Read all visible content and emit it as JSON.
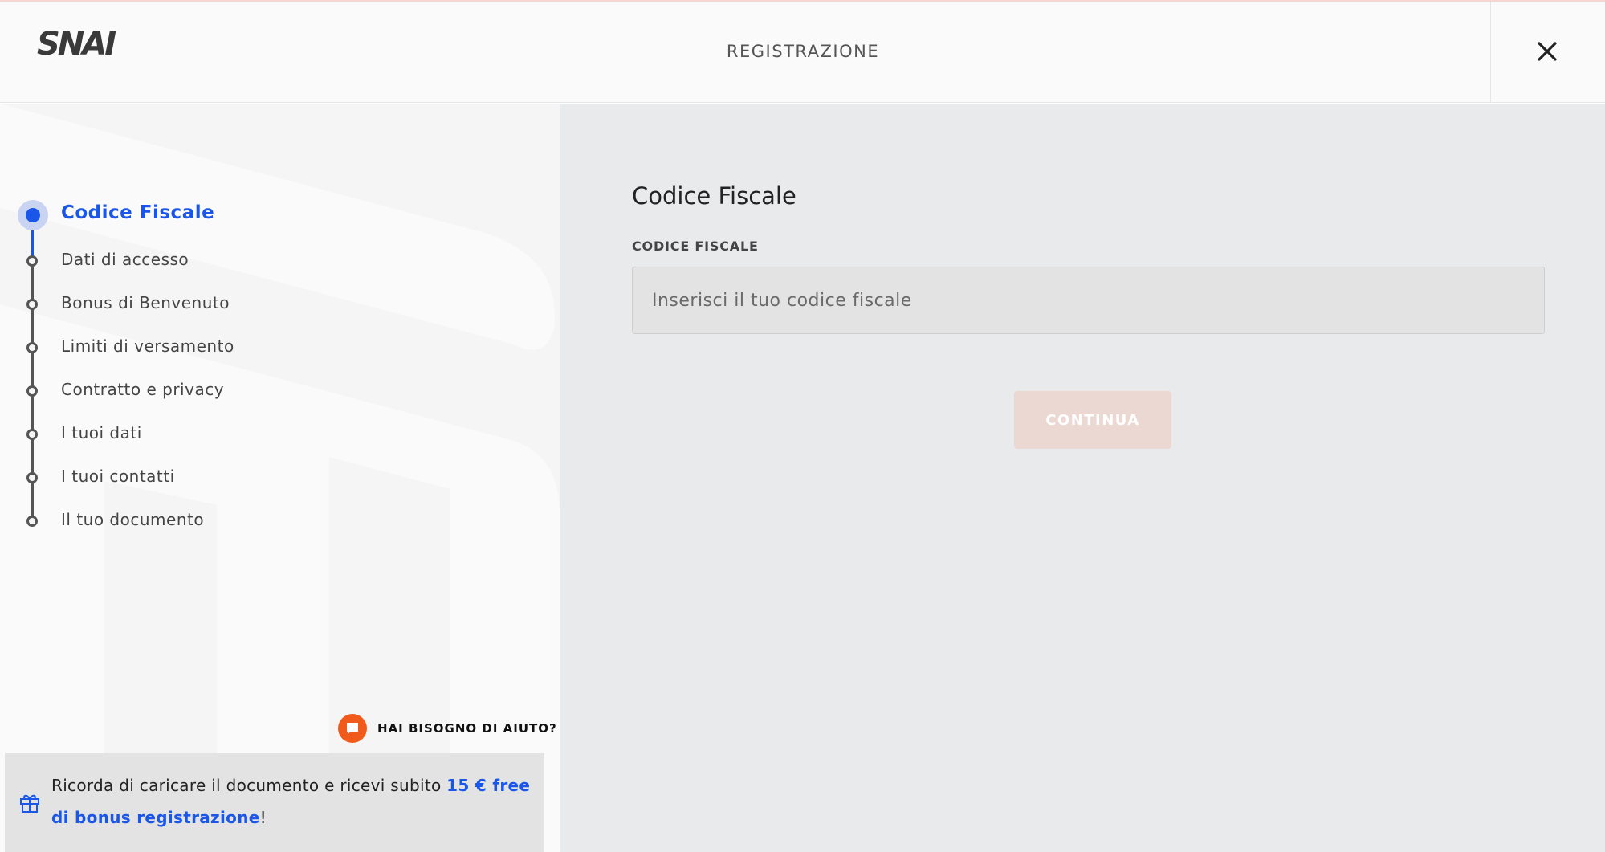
{
  "header": {
    "logo_text": "SNAI",
    "title": "REGISTRAZIONE",
    "close_icon": "close-icon"
  },
  "sidebar": {
    "steps": [
      {
        "label": "Codice Fiscale",
        "active": true
      },
      {
        "label": "Dati di accesso",
        "active": false
      },
      {
        "label": "Bonus di Benvenuto",
        "active": false
      },
      {
        "label": "Limiti di versamento",
        "active": false
      },
      {
        "label": "Contratto e privacy",
        "active": false
      },
      {
        "label": "I tuoi dati",
        "active": false
      },
      {
        "label": "I tuoi contatti",
        "active": false
      },
      {
        "label": "Il tuo documento",
        "active": false
      }
    ],
    "help": {
      "icon": "chat-icon",
      "label": "HAI BISOGNO DI AIUTO?"
    },
    "promo": {
      "icon": "gift-icon",
      "text": "Ricorda di caricare il documento e ricevi subito ",
      "link": "15 € free di bonus registrazione",
      "suffix": "!"
    }
  },
  "form": {
    "title": "Codice Fiscale",
    "field_label": "CODICE FISCALE",
    "input_value": "",
    "input_placeholder": "Inserisci il tuo codice fiscale",
    "continue_label": "CONTINUA"
  },
  "colors": {
    "accent": "#1a56e8",
    "help_orange": "#f05a1a",
    "main_bg": "#e8eaec",
    "sidebar_bg": "#f5f5f5",
    "disabled_button": "#ecd8d2"
  }
}
